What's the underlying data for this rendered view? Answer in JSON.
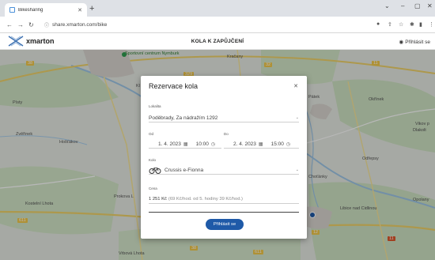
{
  "browser": {
    "tab_title": "Bikesharing",
    "url": "share.xmarton.com/bike"
  },
  "site": {
    "logo": "xmarton",
    "title": "KOLA K ZAPŮJČENÍ",
    "login": "Přihlásit se"
  },
  "map": {
    "labels": {
      "sportovni": "Sportovní\ncentrum Nymburk",
      "kracany": "Kračany",
      "pisty": "Písty",
      "zvirinek": "Zvěřinek",
      "hostakov": "Hošťákov",
      "kostelni": "Kostelní Lhota",
      "prokova": "Prokova L",
      "vrbova": "Vrbová Lhota",
      "palek": "Pátek",
      "okrinek": "Okřínek",
      "vikov": "Vikov p",
      "dlakolt": "Dlakolt",
      "odrepsy": "Odřepsy",
      "chotany": "Choťánky",
      "libice": "Libice nad\nCidlinou",
      "opolany": "Opolany",
      "k_nymburk": "Kl"
    },
    "road_numbers": [
      "38",
      "329",
      "11",
      "32",
      "611",
      "611",
      "38",
      "11",
      "12"
    ]
  },
  "modal": {
    "title": "Rezervace kola",
    "location_label": "Lokalita",
    "location_value": "Poděbrady, Za nádražím 1292",
    "from_label": "Od",
    "from_date": "1. 4. 2023",
    "from_time": "10:00",
    "to_label": "Do",
    "to_date": "2. 4. 2023",
    "to_time": "15:00",
    "bike_label": "Kolo",
    "bike_value": "Crussis e-Fionna",
    "price_label": "Cena",
    "price_value": "1 251 Kč",
    "price_detail": "(69 Kč/hod. od 5. hodiny 39 Kč/hod.)",
    "submit": "Přihlásit se"
  }
}
